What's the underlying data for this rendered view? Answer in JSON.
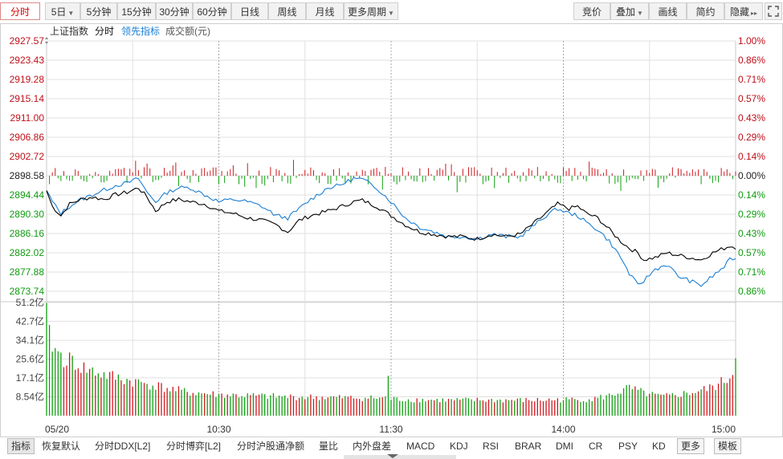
{
  "toolbar": {
    "left": [
      {
        "label": "分时",
        "active": true,
        "caret": false
      },
      {
        "label": "5日",
        "active": false,
        "caret": true
      },
      {
        "label": "5分钟",
        "active": false,
        "caret": false
      },
      {
        "label": "15分钟",
        "active": false,
        "caret": false
      },
      {
        "label": "30分钟",
        "active": false,
        "caret": false
      },
      {
        "label": "60分钟",
        "active": false,
        "caret": false
      },
      {
        "label": "日线",
        "active": false,
        "caret": false
      },
      {
        "label": "周线",
        "active": false,
        "caret": false
      },
      {
        "label": "月线",
        "active": false,
        "caret": false
      },
      {
        "label": "更多周期",
        "active": false,
        "caret": true
      }
    ],
    "right": [
      {
        "label": "竞价",
        "caret": false
      },
      {
        "label": "叠加",
        "caret": true
      },
      {
        "label": "画线",
        "caret": false
      },
      {
        "label": "简约",
        "caret": false
      },
      {
        "label": "隐藏",
        "caret": false,
        "arrow": "▸▸"
      }
    ],
    "fullscreen_icon": "fullscreen-icon"
  },
  "legend": {
    "index_name": "上证指数",
    "mode": "分时",
    "lead_indicator": "领先指标",
    "volume_label": "成交额(元)"
  },
  "colors": {
    "up": "#d0191f",
    "down": "#10a010",
    "price_line": "#000000",
    "lead_line": "#1a7fd4",
    "grid": "#e0e0e0",
    "axis_text_up": "#c0101a",
    "axis_text_down": "#0f9a0f"
  },
  "chart_data": {
    "type": "line",
    "prev_close": 2898.58,
    "y_left_ticks": [
      "2927.57",
      "2923.43",
      "2919.28",
      "2915.14",
      "2911.00",
      "2906.86",
      "2902.72",
      "2898.58",
      "2894.44",
      "2890.30",
      "2886.16",
      "2882.02",
      "2877.88",
      "2873.74"
    ],
    "y_right_ticks": [
      "1.00%",
      "0.86%",
      "0.71%",
      "0.57%",
      "0.43%",
      "0.29%",
      "0.14%",
      "0.00%",
      "0.14%",
      "0.29%",
      "0.43%",
      "0.57%",
      "0.71%",
      "0.86%"
    ],
    "ylim": [
      2871.67,
      2927.57
    ],
    "x_ticks": [
      "05/20",
      "10:30",
      "11:30",
      "14:00",
      "15:00"
    ],
    "x_points": 241,
    "price_keys": [
      [
        0,
        2895.4
      ],
      [
        2,
        2892.0
      ],
      [
        5,
        2890.0
      ],
      [
        8,
        2892.5
      ],
      [
        12,
        2893.5
      ],
      [
        16,
        2894.0
      ],
      [
        20,
        2893.5
      ],
      [
        24,
        2894.5
      ],
      [
        28,
        2895.0
      ],
      [
        32,
        2896.0
      ],
      [
        35,
        2894.0
      ],
      [
        38,
        2891.0
      ],
      [
        42,
        2893.0
      ],
      [
        46,
        2893.5
      ],
      [
        50,
        2893.0
      ],
      [
        55,
        2892.5
      ],
      [
        60,
        2891.0
      ],
      [
        65,
        2890.5
      ],
      [
        70,
        2889.5
      ],
      [
        75,
        2889.0
      ],
      [
        80,
        2888.0
      ],
      [
        84,
        2886.5
      ],
      [
        88,
        2889.0
      ],
      [
        92,
        2890.0
      ],
      [
        98,
        2891.0
      ],
      [
        102,
        2891.8
      ],
      [
        107,
        2893.0
      ],
      [
        110,
        2893.3
      ],
      [
        115,
        2892.0
      ],
      [
        120,
        2890.0
      ],
      [
        125,
        2888.0
      ],
      [
        130,
        2886.5
      ],
      [
        135,
        2886.0
      ],
      [
        140,
        2885.5
      ],
      [
        145,
        2885.5
      ],
      [
        150,
        2885.0
      ],
      [
        155,
        2886.0
      ],
      [
        160,
        2885.5
      ],
      [
        165,
        2886.0
      ],
      [
        168,
        2887.5
      ],
      [
        172,
        2889.5
      ],
      [
        175,
        2891.0
      ],
      [
        178,
        2892.5
      ],
      [
        182,
        2891.5
      ],
      [
        185,
        2892.0
      ],
      [
        188,
        2890.5
      ],
      [
        192,
        2889.5
      ],
      [
        196,
        2887.0
      ],
      [
        200,
        2884.5
      ],
      [
        203,
        2883.0
      ],
      [
        206,
        2882.0
      ],
      [
        208,
        2880.5
      ],
      [
        212,
        2881.0
      ],
      [
        216,
        2882.0
      ],
      [
        220,
        2881.5
      ],
      [
        224,
        2881.0
      ],
      [
        228,
        2880.5
      ],
      [
        232,
        2882.0
      ],
      [
        236,
        2883.0
      ],
      [
        238,
        2883.5
      ],
      [
        240,
        2883.2
      ]
    ],
    "lead_keys": [
      [
        0,
        2895.4
      ],
      [
        2,
        2893.0
      ],
      [
        5,
        2890.5
      ],
      [
        8,
        2892.0
      ],
      [
        12,
        2893.5
      ],
      [
        16,
        2894.5
      ],
      [
        20,
        2895.5
      ],
      [
        24,
        2896.5
      ],
      [
        28,
        2897.0
      ],
      [
        32,
        2898.0
      ],
      [
        35,
        2895.0
      ],
      [
        38,
        2893.0
      ],
      [
        42,
        2895.0
      ],
      [
        46,
        2896.0
      ],
      [
        50,
        2896.0
      ],
      [
        55,
        2894.5
      ],
      [
        60,
        2893.0
      ],
      [
        65,
        2893.5
      ],
      [
        70,
        2893.0
      ],
      [
        75,
        2892.0
      ],
      [
        80,
        2890.0
      ],
      [
        84,
        2889.5
      ],
      [
        88,
        2891.5
      ],
      [
        92,
        2893.5
      ],
      [
        98,
        2896.0
      ],
      [
        102,
        2896.5
      ],
      [
        107,
        2898.0
      ],
      [
        110,
        2897.8
      ],
      [
        115,
        2896.0
      ],
      [
        120,
        2893.0
      ],
      [
        125,
        2889.5
      ],
      [
        130,
        2887.5
      ],
      [
        135,
        2886.5
      ],
      [
        140,
        2885.5
      ],
      [
        145,
        2885.5
      ],
      [
        150,
        2885.0
      ],
      [
        155,
        2886.0
      ],
      [
        160,
        2885.5
      ],
      [
        165,
        2885.5
      ],
      [
        168,
        2887.0
      ],
      [
        172,
        2889.0
      ],
      [
        175,
        2890.5
      ],
      [
        178,
        2891.5
      ],
      [
        182,
        2890.5
      ],
      [
        185,
        2890.0
      ],
      [
        188,
        2888.5
      ],
      [
        192,
        2887.0
      ],
      [
        196,
        2884.5
      ],
      [
        200,
        2881.0
      ],
      [
        203,
        2877.5
      ],
      [
        206,
        2875.0
      ],
      [
        208,
        2876.0
      ],
      [
        212,
        2878.5
      ],
      [
        216,
        2879.5
      ],
      [
        220,
        2877.0
      ],
      [
        224,
        2876.0
      ],
      [
        228,
        2875.0
      ],
      [
        232,
        2877.0
      ],
      [
        236,
        2879.0
      ],
      [
        238,
        2880.5
      ],
      [
        240,
        2881.0
      ]
    ],
    "vol_ticks": [
      "51.2亿",
      "42.7亿",
      "34.1亿",
      "25.6亿",
      "17.1亿",
      "8.54亿"
    ],
    "vol_max": 51.2,
    "vol_keys": [
      [
        0,
        51.0
      ],
      [
        1,
        35.0
      ],
      [
        2,
        33.0
      ],
      [
        3,
        30.0
      ],
      [
        4,
        28.0
      ],
      [
        6,
        26.0
      ],
      [
        8,
        25.0
      ],
      [
        10,
        24.0
      ],
      [
        12,
        22.0
      ],
      [
        15,
        20.5
      ],
      [
        20,
        18.5
      ],
      [
        25,
        17.0
      ],
      [
        30,
        15.5
      ],
      [
        35,
        14.5
      ],
      [
        40,
        13.0
      ],
      [
        45,
        11.5
      ],
      [
        50,
        10.5
      ],
      [
        55,
        10.0
      ],
      [
        60,
        9.5
      ],
      [
        70,
        9.0
      ],
      [
        80,
        8.6
      ],
      [
        90,
        8.4
      ],
      [
        100,
        8.2
      ],
      [
        110,
        8.0
      ],
      [
        119,
        8.0
      ],
      [
        120,
        7.5
      ],
      [
        130,
        7.2
      ],
      [
        140,
        7.0
      ],
      [
        150,
        7.0
      ],
      [
        160,
        7.0
      ],
      [
        170,
        7.0
      ],
      [
        180,
        7.2
      ],
      [
        190,
        7.5
      ],
      [
        196,
        9.0
      ],
      [
        200,
        11.0
      ],
      [
        203,
        12.5
      ],
      [
        206,
        11.0
      ],
      [
        210,
        9.5
      ],
      [
        215,
        8.5
      ],
      [
        220,
        9.5
      ],
      [
        225,
        10.5
      ],
      [
        230,
        12.0
      ],
      [
        234,
        14.0
      ],
      [
        237,
        16.5
      ],
      [
        239,
        19.0
      ],
      [
        240,
        30.0
      ]
    ]
  },
  "bottom_tabs": [
    {
      "label": "指标",
      "active": true
    },
    {
      "label": "恢复默认",
      "active": false
    },
    {
      "label": "分时DDX[L2]",
      "active": false
    },
    {
      "label": "分时博弈[L2]",
      "active": false
    },
    {
      "label": "分时沪股通净额",
      "active": false
    },
    {
      "label": "量比",
      "active": false
    },
    {
      "label": "内外盘差",
      "active": false
    },
    {
      "label": "MACD",
      "active": false
    },
    {
      "label": "KDJ",
      "active": false
    },
    {
      "label": "RSI",
      "active": false
    },
    {
      "label": "BRAR",
      "active": false
    },
    {
      "label": "DMI",
      "active": false
    },
    {
      "label": "CR",
      "active": false
    },
    {
      "label": "PSY",
      "active": false
    },
    {
      "label": "KD",
      "active": false
    },
    {
      "label": "更多",
      "active": false,
      "boxed": true
    },
    {
      "label": "模板",
      "active": false,
      "boxed": true
    }
  ]
}
